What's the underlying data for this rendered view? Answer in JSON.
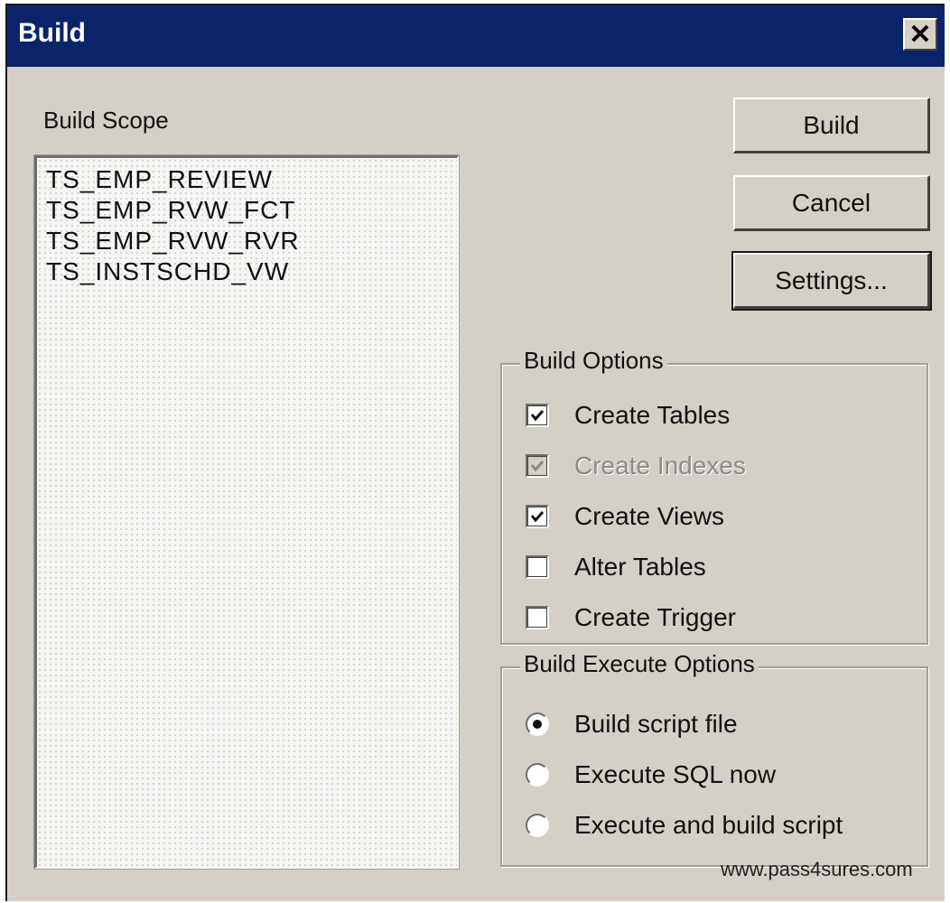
{
  "window": {
    "title": "Build",
    "close_glyph": "✕"
  },
  "build_scope": {
    "label": "Build Scope",
    "items": [
      "TS_EMP_REVIEW",
      "TS_EMP_RVW_FCT",
      "TS_EMP_RVW_RVR",
      "TS_INSTSCHD_VW"
    ]
  },
  "buttons": {
    "build": "Build",
    "cancel": "Cancel",
    "settings": "Settings..."
  },
  "build_options": {
    "legend": "Build Options",
    "options": [
      {
        "label": "Create Tables",
        "checked": true,
        "enabled": true
      },
      {
        "label": "Create Indexes",
        "checked": true,
        "enabled": false
      },
      {
        "label": "Create Views",
        "checked": true,
        "enabled": true
      },
      {
        "label": "Alter Tables",
        "checked": false,
        "enabled": true
      },
      {
        "label": "Create Trigger",
        "checked": false,
        "enabled": true
      }
    ]
  },
  "execute_options": {
    "legend": "Build Execute Options",
    "selected_index": 0,
    "options": [
      "Build script file",
      "Execute SQL now",
      "Execute and build script"
    ]
  },
  "watermark": "www.pass4sures.com",
  "colors": {
    "titlebar": "#0a246a",
    "dialog_bg": "#d4d0c8"
  }
}
